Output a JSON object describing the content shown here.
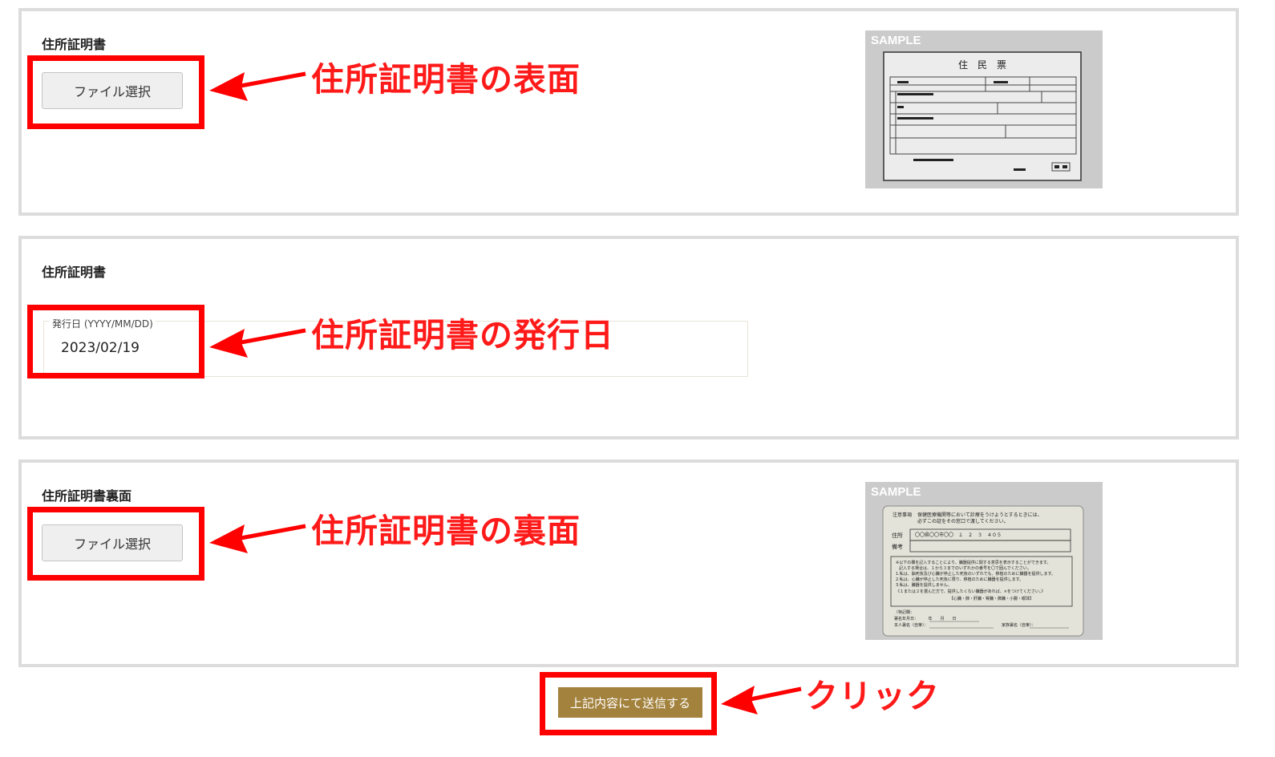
{
  "section1": {
    "title": "住所証明書",
    "file_button": "ファイル選択",
    "annotation": "住所証明書の表面",
    "sample": {
      "label": "SAMPLE",
      "doc_title": "住　民　票"
    }
  },
  "section2": {
    "title": "住所証明書",
    "date_label": "発行日 (YYYY/MM/DD)",
    "date_value": "2023/02/19",
    "annotation": "住所証明書の発行日"
  },
  "section3": {
    "title": "住所証明書裏面",
    "file_button": "ファイル選択",
    "annotation": "住所証明書の裏面",
    "sample": {
      "label": "SAMPLE",
      "notice_heading": "注意事項",
      "notice_line1": "保健医療機関等において診療をうけようとするときには、",
      "notice_line2": "必ずこの証をその窓口で渡してください。",
      "address_label": "住所",
      "address_value": "〇〇県〇〇市〇〇　１　２　３　４０５",
      "remarks_label": "備考",
      "body_lines": [
        "※以下の欄を記入することにより、臓器提供に関する意思を表示することができます。",
        "記入する場合は、１から３までのいずれかの番号を〇で囲んでください。",
        "1.私は、脳死後及び心臓が停止した死後のいずれでも、移植のために臓器を提供します。",
        "2.私は、心臓が停止した死後に限り、移植のために臓器を提供します。",
        "3.私は、臓器を提供しません。",
        "《１または２を選んだ方で、提供したくない臓器があれば、×をつけてください。》",
        "【心臓・肺・肝臓・腎臓・膵臓・小腸・眼球】"
      ],
      "special_note": "〔特記欄：",
      "sign_date": "署名年月日：　　　年　　月　　日",
      "sign_self": "本人署名（自筆）：",
      "sign_family": "家族署名（自筆）："
    }
  },
  "submit": {
    "label": "上記内容にて送信する",
    "annotation": "クリック"
  },
  "colors": {
    "annotation_red": "#ff1a1a",
    "submit_bg": "#a3823d",
    "panel_border": "#dcdcdc"
  }
}
